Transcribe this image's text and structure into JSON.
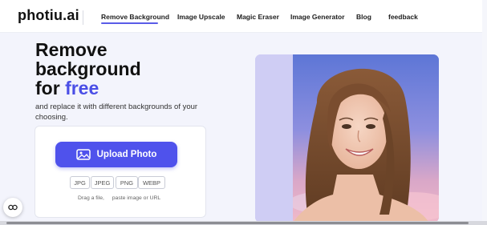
{
  "header": {
    "logo": "photiu.ai",
    "nav": [
      {
        "label": "Remove Background",
        "active": true
      },
      {
        "label": "Image Upscale"
      },
      {
        "label": "Magic Eraser"
      },
      {
        "label": "Image Generator"
      },
      {
        "label": "Blog"
      },
      {
        "label": "feedback"
      }
    ]
  },
  "hero": {
    "title_line1": "Remove",
    "title_line2": "background",
    "title_line3_prefix": "for",
    "title_line3_highlight": "free",
    "subtitle": "and replace it with different backgrounds of your choosing.",
    "upload_button": "Upload Photo",
    "formats": [
      "JPG",
      "JPEG",
      "PNG",
      "WEBP"
    ],
    "hint_drag": "Drag a file,",
    "hint_paste": "paste image or URL"
  },
  "colors": {
    "accent": "#4f52ec",
    "highlight_text": "#4a4ee6",
    "hero_bg": "#f3f4fc"
  },
  "icons": {
    "upload": "image-icon",
    "chat": "chat-icon"
  }
}
